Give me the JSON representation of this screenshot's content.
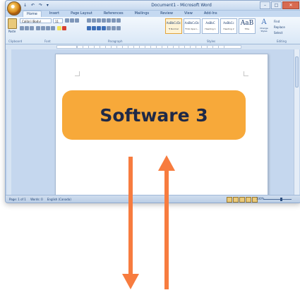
{
  "window": {
    "title": "Document1 - Microsoft Word",
    "qat": [
      "↓",
      "↶",
      "↷",
      "▾"
    ],
    "controls": {
      "minimize": "–",
      "maximize": "□",
      "close": "✕"
    }
  },
  "ribbon": {
    "tabs": [
      "Home",
      "Insert",
      "Page Layout",
      "References",
      "Mailings",
      "Review",
      "View",
      "Add-Ins"
    ],
    "paste_label": "Paste",
    "font_name": "Calibri (Body)",
    "font_size": "11",
    "groups": [
      "Clipboard",
      "Font",
      "Paragraph",
      "Styles",
      "Editing"
    ],
    "styles": [
      {
        "sample": "AaBbCcDc",
        "name": "¶ Normal"
      },
      {
        "sample": "AaBbCcDc",
        "name": "¶ No Spaci..."
      },
      {
        "sample": "AaBbC",
        "name": "Heading 1"
      },
      {
        "sample": "AaBbCc",
        "name": "Heading 2"
      },
      {
        "sample": "AaB",
        "name": "Title"
      }
    ],
    "change_styles": {
      "glyph": "A",
      "label": "Change Styles"
    },
    "editing": [
      "Find",
      "Replace",
      "Select"
    ]
  },
  "status": {
    "page": "Page: 1 of 1",
    "words": "Words: 0",
    "language": "English (Canada)",
    "zoom": "100%"
  },
  "callout": {
    "text": "Software 3",
    "bg": "#f7a93a",
    "text_color": "#1f2947"
  },
  "arrows": {
    "color": "#f77c3f",
    "down_label": "down-arrow",
    "up_label": "up-arrow"
  }
}
